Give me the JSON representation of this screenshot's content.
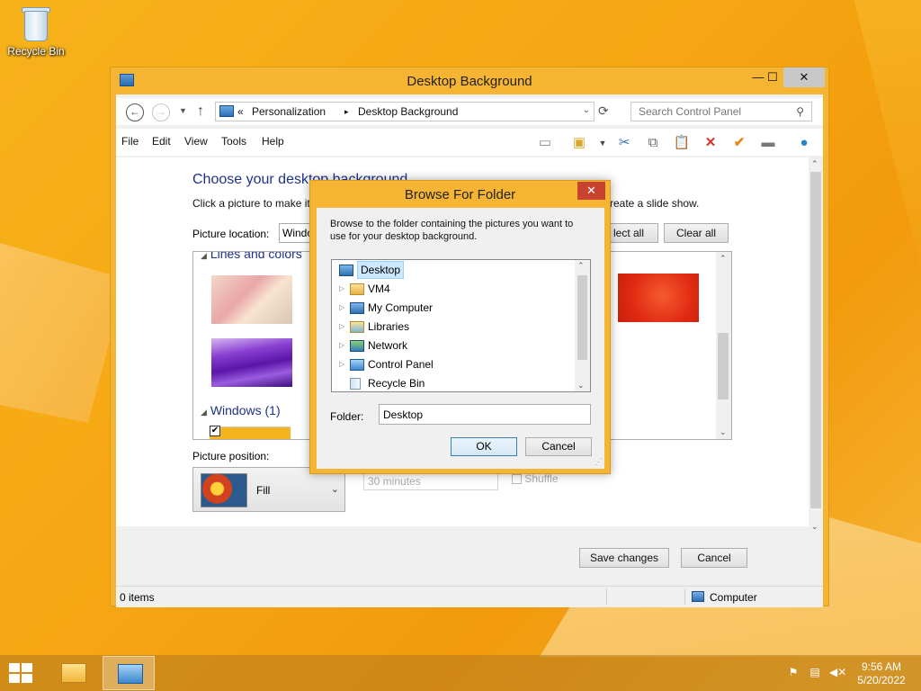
{
  "desktop": {
    "recycle_bin_label": "Recycle Bin"
  },
  "window": {
    "title": "Desktop Background",
    "controls": {
      "minimize": "—",
      "maximize": "☐",
      "close": "✕"
    },
    "address": {
      "chevrons": "«",
      "crumb1": "Personalization",
      "sep": "▸",
      "crumb2": "Desktop Background"
    },
    "search": {
      "placeholder": "Search Control Panel"
    },
    "menu": [
      "File",
      "Edit",
      "View",
      "Tools",
      "Help"
    ],
    "content": {
      "heading": "Choose your desktop background",
      "subtext": "Click a picture to make it",
      "subtext_tail": "reate a slide show.",
      "picture_location_label": "Picture location:",
      "picture_location_value": "Windo",
      "select_all": "lect all",
      "clear_all": "Clear all",
      "group_lines": "Lines and colors",
      "group_windows": "Windows (1)",
      "picture_position_label": "Picture position:",
      "picture_position_value": "Fill",
      "interval_value": "30 minutes",
      "shuffle_label": "Shuffle"
    },
    "buttons": {
      "save": "Save changes",
      "cancel": "Cancel"
    },
    "status": {
      "items": "0 items",
      "location": "Computer"
    }
  },
  "dialog": {
    "title": "Browse For Folder",
    "close": "✕",
    "description": "Browse to the folder containing the pictures you want to use for your desktop background.",
    "tree": [
      "Desktop",
      "VM4",
      "My Computer",
      "Libraries",
      "Network",
      "Control Panel",
      "Recycle Bin"
    ],
    "folder_label": "Folder:",
    "folder_value": "Desktop",
    "ok": "OK",
    "cancel": "Cancel"
  },
  "taskbar": {
    "time": "9:56 AM",
    "date": "5/20/2022"
  }
}
